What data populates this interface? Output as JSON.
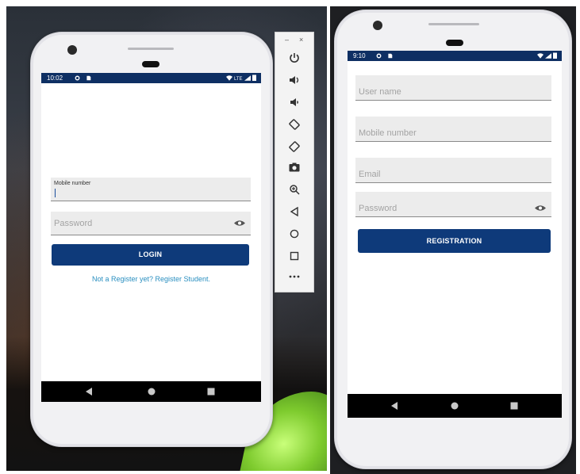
{
  "left_phone": {
    "status_time": "10:02",
    "status_network": "LTE",
    "mobile_label": "Mobile number",
    "password_placeholder": "Password",
    "login_label": "LOGIN",
    "register_link": "Not a Register yet? Register Student."
  },
  "right_phone": {
    "status_time": "9:10",
    "username_placeholder": "User name",
    "mobile_placeholder": "Mobile number",
    "email_placeholder": "Email",
    "password_placeholder": "Password",
    "registration_label": "REGISTRATION"
  },
  "emulator_toolbar": {
    "minimize": "–",
    "close": "×",
    "items": [
      "power-icon",
      "volume-up-icon",
      "volume-down-icon",
      "rotate-left-icon",
      "rotate-right-icon",
      "screenshot-icon",
      "zoom-icon",
      "back-icon",
      "home-icon",
      "overview-icon",
      "more-icon"
    ]
  },
  "colors": {
    "accent": "#0e3a7a",
    "status_bar": "#0e2f63",
    "link": "#2a8fc0"
  }
}
